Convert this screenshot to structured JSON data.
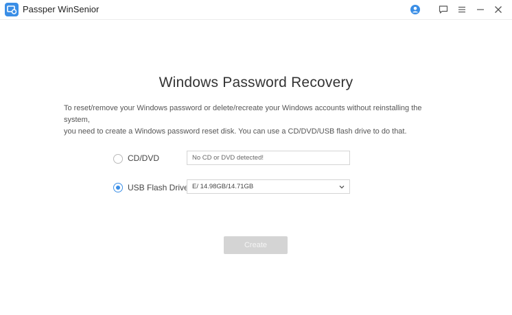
{
  "titlebar": {
    "app_title": "Passper WinSenior",
    "icons": [
      "app-logo-icon",
      "user-icon",
      "feedback-icon",
      "menu-icon",
      "minimize-icon",
      "close-icon"
    ]
  },
  "main": {
    "heading": "Windows Password Recovery",
    "description_line1": "To reset/remove your Windows password or delete/recreate your Windows accounts without reinstalling the system,",
    "description_line2": "you need to create a Windows password reset disk. You can use a CD/DVD/USB flash drive to do that.",
    "options": [
      {
        "label": "CD/DVD",
        "value": "No CD or DVD detected!",
        "selected": false
      },
      {
        "label": "USB Flash Drive",
        "value": "E/ 14.98GB/14.71GB",
        "selected": true
      }
    ],
    "create_label": "Create"
  },
  "colors": {
    "accent": "#3a8ee6",
    "button_disabled": "#d4d4d4"
  }
}
